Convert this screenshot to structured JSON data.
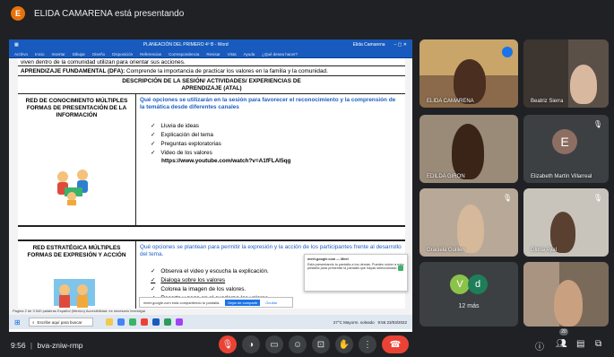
{
  "presenter": {
    "initial": "E",
    "banner": "ELIDA CAMARENA está presentando"
  },
  "word": {
    "doc_title": "PLANEACIÓN DEL PRIMERO 4º B - Word",
    "user": "Elida Camarena",
    "ribbon_tabs": [
      "Archivo",
      "Inicio",
      "Insertar",
      "Dibujar",
      "Diseño",
      "Disposición",
      "Referencias",
      "Correspondencia",
      "Revisar",
      "Vista",
      "Ayuda",
      "¿Qué desea hacer?"
    ],
    "status_text": "Página 2 de 3   540 palabras   Español (México)   Accesibilidad: es necesario investigar"
  },
  "document": {
    "top_line": "viven dentro de la comunidad utilizan para orientar sus acciones.",
    "fundamental_label": "APRENDIZAJE FUNDAMENTAL (DFA):",
    "fundamental_text": "Comprende la importancia de practicar los valores en la familia y la comunidad.",
    "heading_line1": "DESCRIPCIÓN DE LA SESIÓN/ ACTIVIDADES/ EXPERIENCIAS DE",
    "heading_line2": "APRENDIZAJE (ATAL)",
    "section1": {
      "left_title": "RED DE CONOCIMIENTO MÚLTIPLES FORMAS DE PRESENTACIÓN DE LA INFORMACIÓN",
      "question": "Qué opciones se utilizarán en la sesión para favorecer el reconocimiento y la comprensión de la temática desde diferentes canales",
      "items": [
        "Lluvia de ideas",
        "Explicación del tema",
        "Preguntas exploratorias",
        "Video de los valores"
      ],
      "link": "https://www.youtube.com/watch?v=A1fFLAI5qg"
    },
    "section2": {
      "left_title": "RED ESTRATÉGICA MÚLTIPLES FORMAS DE EXPRESIÓN Y ACCIÓN",
      "question": "Qué opciones se plantean para permitir la expresión y la acción de los participantes frente al desarrollo del tema.",
      "items": [
        "Observa el video y escucha la explicación.",
        "Dialoga sobre los valores",
        "Colorea la imagen de los valores.",
        "Recorta y pega en el cuaderno los valores."
      ]
    }
  },
  "notification": {
    "title": "meet.google.com — Meet",
    "body": "Está presentando tu pantalla a los demás. Puedes volver a esta pestaña para presentar la pantalla que hayas seleccionado."
  },
  "sharebar": {
    "text": "meet.google.com está compartiendo tu pantalla.",
    "stop": "Dejar de compartir",
    "hide": "Ocultar"
  },
  "taskbar": {
    "search": "Escribe aquí para buscar",
    "weather": "27°C  Mayorm. soleado",
    "time": "9:56",
    "date": "23/03/2022"
  },
  "participants": [
    {
      "name": "ELIDA CAMARENA"
    },
    {
      "name": "Beatriz Sierra"
    },
    {
      "name": "EDILDA GIRON"
    },
    {
      "name": "Elizabeth Martín Villarreal",
      "initial": "E"
    },
    {
      "name": "Graciela Guillen"
    },
    {
      "name": "Gloria Ayal"
    },
    {
      "name": "12 más",
      "initials": [
        "V",
        "d"
      ]
    },
    {
      "name": ""
    }
  ],
  "bottom": {
    "clock": "9:56",
    "separator": "|",
    "meeting_code": "bva-zniw-rmp",
    "people_count": "20"
  },
  "colors": {
    "meet_bg": "#202124",
    "control_bg": "#3c4043",
    "danger": "#ea4335",
    "word_blue": "#185abd",
    "link_blue": "#1f5fbf"
  }
}
